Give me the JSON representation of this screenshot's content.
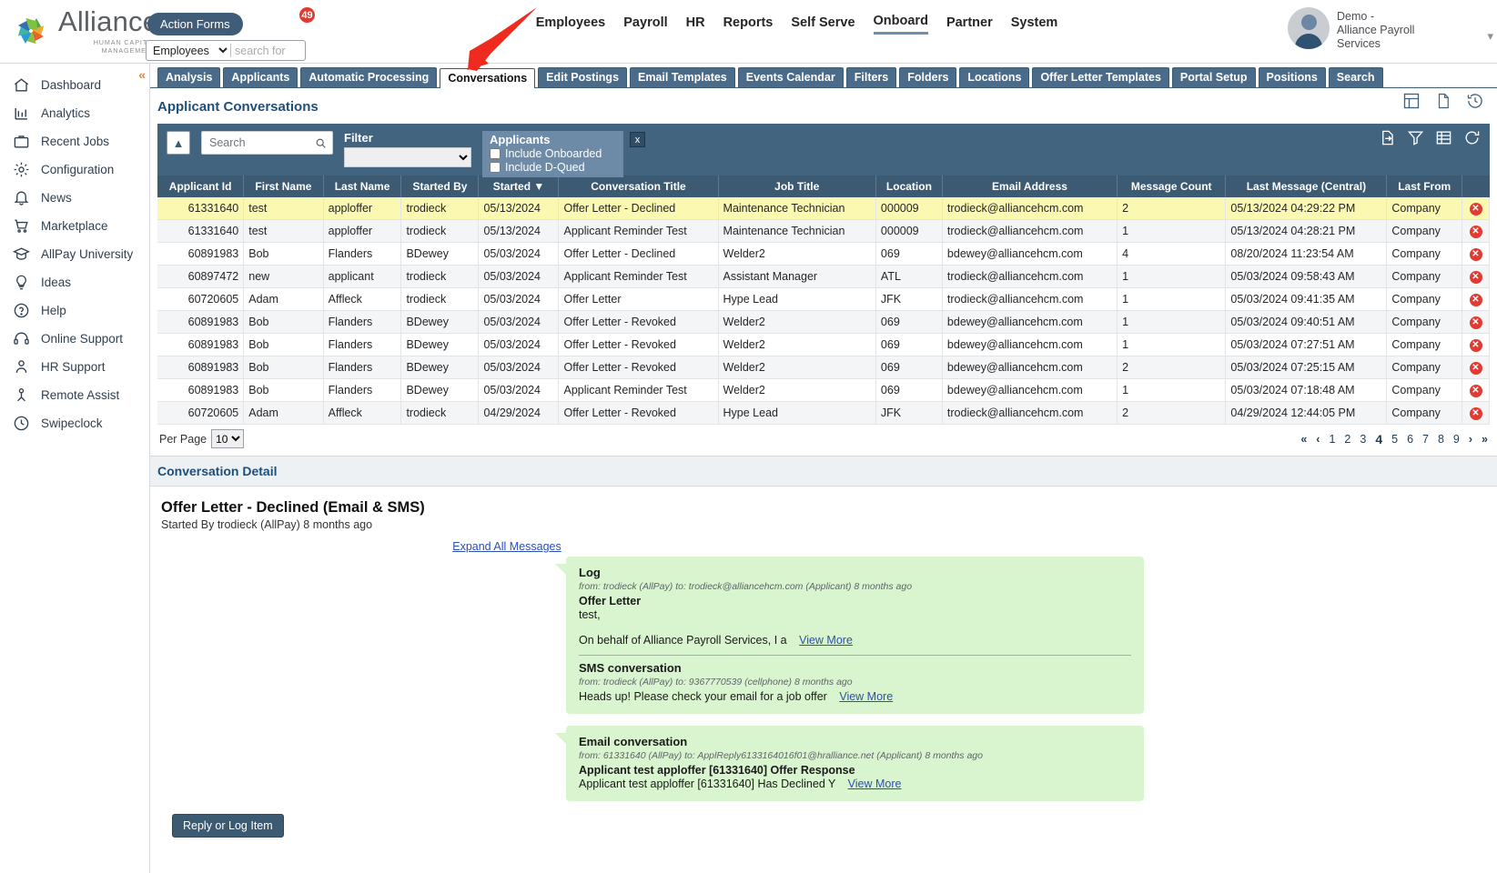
{
  "brand": {
    "name": "Alliance",
    "tagline": "HUMAN CAPITAL MANAGEMENT"
  },
  "topbar": {
    "action_forms_label": "Action Forms",
    "action_forms_badge": "49",
    "search_scope": "Employees",
    "search_placeholder": "search for",
    "search_value": "",
    "nav": [
      {
        "label": "Employees",
        "active": false
      },
      {
        "label": "Payroll",
        "active": false
      },
      {
        "label": "HR",
        "active": false
      },
      {
        "label": "Reports",
        "active": false
      },
      {
        "label": "Self Serve",
        "active": false
      },
      {
        "label": "Onboard",
        "active": true
      },
      {
        "label": "Partner",
        "active": false
      },
      {
        "label": "System",
        "active": false
      }
    ],
    "user": {
      "line1": "Demo -",
      "line2": "Alliance Payroll",
      "line3": "Services"
    }
  },
  "sidebar": {
    "items": [
      {
        "label": "Dashboard",
        "icon": "home-icon"
      },
      {
        "label": "Analytics",
        "icon": "analytics-icon"
      },
      {
        "label": "Recent Jobs",
        "icon": "briefcase-icon"
      },
      {
        "label": "Configuration",
        "icon": "gear-icon"
      },
      {
        "label": "News",
        "icon": "bell-icon"
      },
      {
        "label": "Marketplace",
        "icon": "cart-icon"
      },
      {
        "label": "AllPay University",
        "icon": "graduation-cap-icon"
      },
      {
        "label": "Ideas",
        "icon": "lightbulb-icon"
      },
      {
        "label": "Help",
        "icon": "question-circle-icon"
      },
      {
        "label": "Online Support",
        "icon": "headset-icon"
      },
      {
        "label": "HR Support",
        "icon": "person-icon"
      },
      {
        "label": "Remote Assist",
        "icon": "remote-assist-icon"
      },
      {
        "label": "Swipeclock",
        "icon": "clock-icon"
      }
    ]
  },
  "tabs": [
    {
      "label": "Analysis",
      "active": false
    },
    {
      "label": "Applicants",
      "active": false
    },
    {
      "label": "Automatic Processing",
      "active": false
    },
    {
      "label": "Conversations",
      "active": true
    },
    {
      "label": "Edit Postings",
      "active": false
    },
    {
      "label": "Email Templates",
      "active": false
    },
    {
      "label": "Events Calendar",
      "active": false
    },
    {
      "label": "Filters",
      "active": false
    },
    {
      "label": "Folders",
      "active": false
    },
    {
      "label": "Locations",
      "active": false
    },
    {
      "label": "Offer Letter Templates",
      "active": false
    },
    {
      "label": "Portal Setup",
      "active": false
    },
    {
      "label": "Positions",
      "active": false
    },
    {
      "label": "Search",
      "active": false
    }
  ],
  "page": {
    "title": "Applicant Conversations"
  },
  "filterbar": {
    "search_placeholder": "Search",
    "search_value": "",
    "filter_label": "Filter",
    "filter_value": "",
    "applicants_label": "Applicants",
    "include_onboarded_label": "Include Onboarded",
    "include_onboarded_checked": false,
    "include_dqued_label": "Include D-Qued",
    "include_dqued_checked": false,
    "close_label": "x"
  },
  "table": {
    "columns": [
      "Applicant Id",
      "First Name",
      "Last Name",
      "Started By",
      "Started ▼",
      "Conversation Title",
      "Job Title",
      "Location",
      "Email Address",
      "Message Count",
      "Last Message (Central)",
      "Last From",
      ""
    ],
    "rows": [
      {
        "applicant_id": "61331640",
        "first_name": "test",
        "last_name": "apploffer",
        "started_by": "trodieck",
        "started": "05/13/2024",
        "conversation_title": "Offer Letter - Declined",
        "job_title": "Maintenance Technician",
        "location": "000009",
        "email": "trodieck@alliancehcm.com",
        "message_count": "2",
        "last_message": "05/13/2024 04:29:22 PM",
        "last_from": "Company",
        "selected": true
      },
      {
        "applicant_id": "61331640",
        "first_name": "test",
        "last_name": "apploffer",
        "started_by": "trodieck",
        "started": "05/13/2024",
        "conversation_title": "Applicant Reminder Test",
        "job_title": "Maintenance Technician",
        "location": "000009",
        "email": "trodieck@alliancehcm.com",
        "message_count": "1",
        "last_message": "05/13/2024 04:28:21 PM",
        "last_from": "Company",
        "selected": false
      },
      {
        "applicant_id": "60891983",
        "first_name": "Bob",
        "last_name": "Flanders",
        "started_by": "BDewey",
        "started": "05/03/2024",
        "conversation_title": "Offer Letter - Declined",
        "job_title": "Welder2",
        "location": "069",
        "email": "bdewey@alliancehcm.com",
        "message_count": "4",
        "last_message": "08/20/2024 11:23:54 AM",
        "last_from": "Company",
        "selected": false
      },
      {
        "applicant_id": "60897472",
        "first_name": "new",
        "last_name": "applicant",
        "started_by": "trodieck",
        "started": "05/03/2024",
        "conversation_title": "Applicant Reminder Test",
        "job_title": "Assistant Manager",
        "location": "ATL",
        "email": "trodieck@alliancehcm.com",
        "message_count": "1",
        "last_message": "05/03/2024 09:58:43 AM",
        "last_from": "Company",
        "selected": false
      },
      {
        "applicant_id": "60720605",
        "first_name": "Adam",
        "last_name": "Affleck",
        "started_by": "trodieck",
        "started": "05/03/2024",
        "conversation_title": "Offer Letter",
        "job_title": "Hype Lead",
        "location": "JFK",
        "email": "trodieck@alliancehcm.com",
        "message_count": "1",
        "last_message": "05/03/2024 09:41:35 AM",
        "last_from": "Company",
        "selected": false
      },
      {
        "applicant_id": "60891983",
        "first_name": "Bob",
        "last_name": "Flanders",
        "started_by": "BDewey",
        "started": "05/03/2024",
        "conversation_title": "Offer Letter - Revoked",
        "job_title": "Welder2",
        "location": "069",
        "email": "bdewey@alliancehcm.com",
        "message_count": "1",
        "last_message": "05/03/2024 09:40:51 AM",
        "last_from": "Company",
        "selected": false
      },
      {
        "applicant_id": "60891983",
        "first_name": "Bob",
        "last_name": "Flanders",
        "started_by": "BDewey",
        "started": "05/03/2024",
        "conversation_title": "Offer Letter - Revoked",
        "job_title": "Welder2",
        "location": "069",
        "email": "bdewey@alliancehcm.com",
        "message_count": "1",
        "last_message": "05/03/2024 07:27:51 AM",
        "last_from": "Company",
        "selected": false
      },
      {
        "applicant_id": "60891983",
        "first_name": "Bob",
        "last_name": "Flanders",
        "started_by": "BDewey",
        "started": "05/03/2024",
        "conversation_title": "Offer Letter - Revoked",
        "job_title": "Welder2",
        "location": "069",
        "email": "bdewey@alliancehcm.com",
        "message_count": "2",
        "last_message": "05/03/2024 07:25:15 AM",
        "last_from": "Company",
        "selected": false
      },
      {
        "applicant_id": "60891983",
        "first_name": "Bob",
        "last_name": "Flanders",
        "started_by": "BDewey",
        "started": "05/03/2024",
        "conversation_title": "Applicant Reminder Test",
        "job_title": "Welder2",
        "location": "069",
        "email": "bdewey@alliancehcm.com",
        "message_count": "1",
        "last_message": "05/03/2024 07:18:48 AM",
        "last_from": "Company",
        "selected": false
      },
      {
        "applicant_id": "60720605",
        "first_name": "Adam",
        "last_name": "Affleck",
        "started_by": "trodieck",
        "started": "04/29/2024",
        "conversation_title": "Offer Letter - Revoked",
        "job_title": "Hype Lead",
        "location": "JFK",
        "email": "trodieck@alliancehcm.com",
        "message_count": "2",
        "last_message": "04/29/2024 12:44:05 PM",
        "last_from": "Company",
        "selected": false
      }
    ]
  },
  "pagination": {
    "per_page_label": "Per Page",
    "per_page_value": "10",
    "first": "«",
    "prev": "‹",
    "pages": [
      "1",
      "2",
      "3",
      "4",
      "5",
      "6",
      "7",
      "8",
      "9"
    ],
    "current": "4",
    "next": "›",
    "last": "»"
  },
  "detail": {
    "section_title": "Conversation Detail",
    "title_main": "Offer Letter - Declined",
    "title_suffix": "(Email & SMS)",
    "started_by": "Started By trodieck (AllPay) 8 months ago",
    "expand_all_label": "Expand All Messages",
    "messages": [
      {
        "title": "Log",
        "meta": "from: trodieck (AllPay) to: trodieck@alliancehcm.com (Applicant) 8 months ago",
        "subject": "Offer Letter",
        "body": "test,",
        "body2": "On behalf of Alliance Payroll Services, I a",
        "view_more": "View More",
        "sub_section": {
          "title": "SMS conversation",
          "meta": "from: trodieck (AllPay) to: 9367770539 (cellphone) 8 months ago",
          "body": "Heads up! Please check your email for a job offer",
          "view_more": "View More"
        }
      },
      {
        "title": "Email conversation",
        "meta": "from: 61331640 (AllPay) to: ApplReply6133164016f01@hralliance.net (Applicant) 8 months ago",
        "subject": "Applicant test apploffer [61331640] Offer Response",
        "body": "Applicant test apploffer [61331640] Has Declined Y",
        "view_more": "View More"
      }
    ],
    "reply_button": "Reply or Log Item"
  },
  "colors": {
    "nav_blue": "#3d5a73",
    "tab_blue": "#4a6b8a",
    "filter_blue": "#42647f",
    "selected_row": "#fbf8b2",
    "bubble_green": "#d9f5cf",
    "badge_red": "#e03b32",
    "link_blue": "#2c4fb5",
    "title_blue": "#1f4e79"
  }
}
